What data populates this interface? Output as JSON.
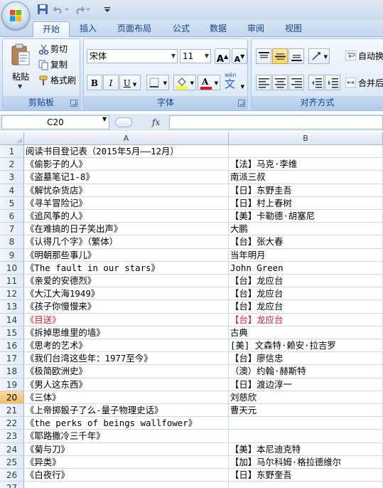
{
  "ribbon_tabs": [
    "开始",
    "插入",
    "页面布局",
    "公式",
    "数据",
    "审阅",
    "视图"
  ],
  "clipboard": {
    "paste": "粘贴",
    "cut": "剪切",
    "copy": "复制",
    "format_painter": "格式刷",
    "group_label": "剪贴板"
  },
  "font": {
    "name": "宋体",
    "size": "11",
    "grow": "A",
    "shrink": "A",
    "bold": "B",
    "italic": "I",
    "underline": "U",
    "phonetic": "wén",
    "phonetic_char": "文",
    "font_color_letter": "A",
    "group_label": "字体"
  },
  "alignment": {
    "wrap": "自动换",
    "merge": "合并后",
    "group_label": "对齐方式"
  },
  "formula_bar": {
    "name_box": "C20",
    "fx": "fx",
    "formula": ""
  },
  "colors": {
    "accent": "#15428b",
    "highlight": "#f1c15f",
    "red_text": "#e0141e"
  },
  "columns": [
    "A",
    "B"
  ],
  "rows": [
    {
      "n": "1",
      "a": "阅读书目登记表（2015年5月——12月）",
      "b": ""
    },
    {
      "n": "2",
      "a": "《偷影子的人》",
      "b": "【法】马克·李维"
    },
    {
      "n": "3",
      "a": "《盗墓笔记1-8》",
      "b": "南派三叔"
    },
    {
      "n": "4",
      "a": "《解忧杂货店》",
      "b": "【日】东野圭吾"
    },
    {
      "n": "5",
      "a": "《寻羊冒险记》",
      "b": "【日】村上春树"
    },
    {
      "n": "6",
      "a": "《追风筝的人》",
      "b": "【美】卡勒德·胡塞尼"
    },
    {
      "n": "7",
      "a": "《在难搞的日子笑出声》",
      "b": "大鹏"
    },
    {
      "n": "8",
      "a": "《认得几个字》（繁体）",
      "b": "【台】张大春"
    },
    {
      "n": "9",
      "a": "《明朝那些事儿》",
      "b": "当年明月"
    },
    {
      "n": "10",
      "a": "《The fault in our stars》",
      "b": "John Green"
    },
    {
      "n": "11",
      "a": "《亲爱的安德烈》",
      "b": "【台】龙应台"
    },
    {
      "n": "12",
      "a": "《大江大海1949》",
      "b": "【台】龙应台"
    },
    {
      "n": "13",
      "a": "《孩子你慢慢来》",
      "b": "【台】龙应台"
    },
    {
      "n": "14",
      "a": "《目送》",
      "b": "【台】龙应台",
      "red": true
    },
    {
      "n": "15",
      "a": "《拆掉思维里的墙》",
      "b": "古典"
    },
    {
      "n": "16",
      "a": "《思考的艺术》",
      "b": "[美] 文森特·赖安·拉吉罗"
    },
    {
      "n": "17",
      "a": "《我们台湾这些年：1977至今》",
      "b": "【台】廖信忠"
    },
    {
      "n": "18",
      "a": "《极简欧洲史》",
      "b": "（澳）约翰·赫斯特"
    },
    {
      "n": "19",
      "a": "《男人这东西》",
      "b": "【日】渡边淳一"
    },
    {
      "n": "20",
      "a": "《三体》",
      "b": "刘慈欣",
      "selected": true
    },
    {
      "n": "21",
      "a": "《上帝掷骰子了么-量子物理史话》",
      "b": "曹天元"
    },
    {
      "n": "22",
      "a": "《the perks of beings wallfower》",
      "b": ""
    },
    {
      "n": "23",
      "a": "《耶路撒冷三千年》",
      "b": ""
    },
    {
      "n": "24",
      "a": "《菊与刀》",
      "b": "【美】本尼迪克特"
    },
    {
      "n": "25",
      "a": "《异类》",
      "b": "【加】马尔科姆·格拉德维尔"
    },
    {
      "n": "26",
      "a": "《白夜行》",
      "b": "【日】东野奎吾"
    },
    {
      "n": "27",
      "a": "",
      "b": ""
    }
  ]
}
